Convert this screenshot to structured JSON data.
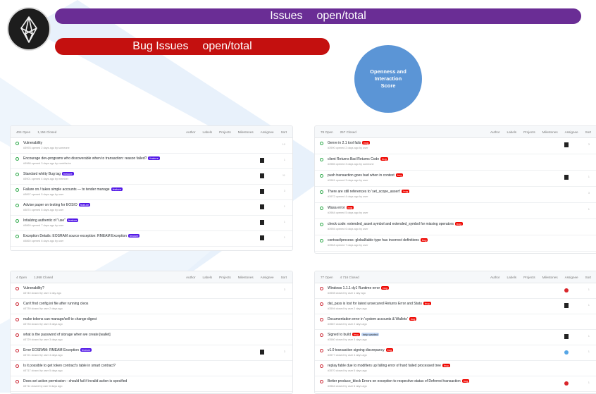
{
  "colors": {
    "purple_bar": "#6a2d95",
    "red_bar": "#c4100f",
    "score_circle": "#5b95d6",
    "label_blue": "#5319e7",
    "label_red": "#ee0701"
  },
  "header": {
    "issues_label": "Issues",
    "issues_metric": "open/total",
    "bug_label": "Bug Issues",
    "bug_metric": "open/total",
    "score_text": "Openness and Interaction Score"
  },
  "panels": [
    {
      "head": [
        "404 Open",
        "1,154 Closed",
        "Author",
        "Labels",
        "Projects",
        "Milestones",
        "Assignee",
        "Sort"
      ],
      "rows": [
        {
          "title": "Vulnerability",
          "meta": "#3993 opened 2 days ago by someone",
          "label": "",
          "label_color": "",
          "avatar": false,
          "count": "10"
        },
        {
          "title": "Encourage dev-programs who discoverable when to transaction: reason failed?",
          "meta": "#3988 opened 3 days ago by contributor",
          "label": "feature",
          "label_color": "blue",
          "avatar": true,
          "count": "1"
        },
        {
          "title": "Standard whitty Bug tag",
          "meta": "#3901 opened 4 days ago by member",
          "label": "feature",
          "label_color": "blue",
          "avatar": true,
          "count": "11"
        },
        {
          "title": "Failure on / takes simple accounts — to tender manage",
          "meta": "#3897 opened 5 days ago by user",
          "label": "feature",
          "label_color": "blue",
          "avatar": true,
          "count": "3"
        },
        {
          "title": "Advise paper on testing for EOSIO",
          "meta": "#3874 opened 6 days ago by user",
          "label": "feature",
          "label_color": "blue",
          "avatar": true,
          "count": "1"
        },
        {
          "title": "Intialzing authentic of \"use\"",
          "meta": "#3869 opened 7 days ago by user",
          "label": "feature",
          "label_color": "blue",
          "avatar": true,
          "count": "1"
        },
        {
          "title": "Exception Details: EOSRAM source exception: RMEAM Exception",
          "meta": "#3860 opened 8 days ago by user",
          "label": "feature",
          "label_color": "blue",
          "avatar": true,
          "count": "1"
        }
      ]
    },
    {
      "head": [
        "78 Open",
        "257 Closed",
        "Author",
        "Labels",
        "Projects",
        "Milestones",
        "Assignee",
        "Sort"
      ],
      "rows": [
        {
          "title": "Genre in 2.1 tool fails",
          "meta": "#3990 opened 2 days ago by user",
          "label": "bug",
          "label_color": "red",
          "avatar": true,
          "count": "3"
        },
        {
          "title": "client Returns Bad Returns Code",
          "meta": "#3985 opened 3 days ago by someone",
          "label": "bug",
          "label_color": "red",
          "avatar": false,
          "count": ""
        },
        {
          "title": "push transaction goes bad when in context",
          "meta": "#3981 opened 3 days ago by user",
          "label": "bug",
          "label_color": "red",
          "avatar": true,
          "count": "1"
        },
        {
          "title": "There are still references to 'set_scope_assert'",
          "meta": "#3972 opened 4 days ago by user",
          "label": "bug",
          "label_color": "red",
          "avatar": false,
          "count": "3"
        },
        {
          "title": "Wasa error",
          "meta": "#3964 opened 5 days ago by user",
          "label": "bug",
          "label_color": "red",
          "avatar": false,
          "count": "1"
        },
        {
          "title": "check code: extended_asset symbol and extended_symbol for missing operators",
          "meta": "#3955 opened 6 days ago by user",
          "label": "bug",
          "label_color": "red",
          "avatar": false,
          "count": ""
        },
        {
          "title": "contract/process: global/table type has incorrect definitions",
          "meta": "#3948 opened 7 days ago by user",
          "label": "bug",
          "label_color": "red",
          "avatar": false,
          "count": ""
        }
      ]
    },
    {
      "head": [
        "4 Open",
        "1,958 Closed",
        "Author",
        "Labels",
        "Projects",
        "Milestones",
        "Assignee",
        "Sort"
      ],
      "rows": [
        {
          "title": "Vulnerability?",
          "meta": "#3740 closed by user 1 day ago",
          "label": "",
          "label_color": "",
          "avatar": false,
          "count": "3"
        },
        {
          "title": "Can't find config.ini file after running cleos",
          "meta": "#3739 closed by user 2 days ago",
          "label": "",
          "label_color": "",
          "avatar": false,
          "count": ""
        },
        {
          "title": "make tokens can manage/sell to change digest",
          "meta": "#3733 closed by user 3 days ago",
          "label": "",
          "label_color": "",
          "avatar": false,
          "count": ""
        },
        {
          "title": "what is the password of storage when we create [wallet]",
          "meta": "#3729 closed by user 3 days ago",
          "label": "",
          "label_color": "",
          "avatar": false,
          "count": ""
        },
        {
          "title": "Error EOSRAM: RMEAM Exception",
          "meta": "#3721 closed by user 4 days ago",
          "label": "feature",
          "label_color": "blue",
          "avatar": true,
          "count": "3"
        },
        {
          "title": "Is it possible to get token contract's table in smart contract?",
          "meta": "#3717 closed by user 5 days ago",
          "label": "",
          "label_color": "",
          "avatar": false,
          "count": ""
        },
        {
          "title": "Does set action permission - should fail if invalid action is specified",
          "meta": "#3711 closed by user 6 days ago",
          "label": "",
          "label_color": "",
          "avatar": false,
          "count": ""
        }
      ]
    },
    {
      "head": [
        "77 Open",
        "4 716 Closed",
        "Author",
        "Labels",
        "Projects",
        "Milestones",
        "Assignee",
        "Sort"
      ],
      "rows": [
        {
          "title": "Windows 1.1.1 dy1 Runtime error",
          "meta": "#3598 closed by user 1 day ago",
          "label": "bug",
          "label_color": "red",
          "avatar": "red",
          "count": "1"
        },
        {
          "title": "dat_pass is lost for latest unsecured Returns Error and Statu",
          "meta": "#3594 closed by user 2 days ago",
          "label": "bug",
          "label_color": "red",
          "avatar": true,
          "count": "1"
        },
        {
          "title": "Documentation error in 'system accounts & Wallets'",
          "meta": "#3587 closed by user 2 days ago",
          "label": "bug",
          "label_color": "red",
          "avatar": false,
          "count": ""
        },
        {
          "title": "Signed to build",
          "meta": "#3580 closed by user 3 days ago",
          "label": "bug",
          "label_color": "red",
          "label2": "help wanted",
          "avatar": true,
          "count": "1"
        },
        {
          "title": "v1.0 transaction signing discrepancy",
          "meta": "#3577 closed by user 4 days ago",
          "label": "bug",
          "label_color": "red",
          "avatar": "blue",
          "count": "1"
        },
        {
          "title": "replay fable due to modifiers up falling error of hard failed processed tree",
          "meta": "#3570 closed by user 5 days ago",
          "label": "bug",
          "label_color": "red",
          "avatar": false,
          "count": ""
        },
        {
          "title": "Better produce_block Errors on exception to respective status of Deferred transaction",
          "meta": "#3564 closed by user 6 days ago",
          "label": "bug",
          "label_color": "red",
          "avatar": "red",
          "count": "1"
        }
      ]
    }
  ]
}
